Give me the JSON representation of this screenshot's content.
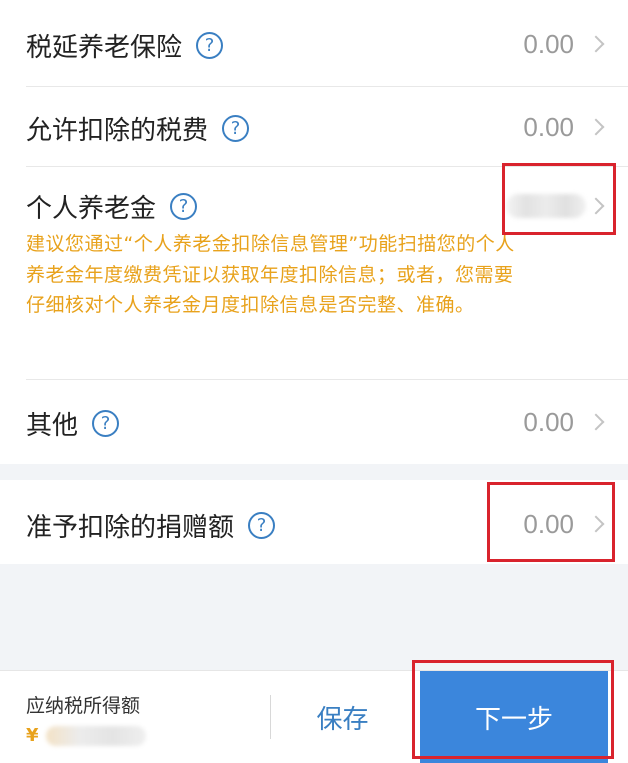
{
  "rows": [
    {
      "label": "税延养老保险",
      "help": "?",
      "value": "0.00"
    },
    {
      "label": "允许扣除的税费",
      "help": "?",
      "value": "0.00"
    },
    {
      "label": "个人养老金",
      "help": "?",
      "value": "",
      "note": "建议您通过“个人养老金扣除信息管理”功能扫描您的个人养老金年度缴费凭证以获取年度扣除信息；或者，您需要仔细核对个人养老金月度扣除信息是否完整、准确。"
    },
    {
      "label": "其他",
      "help": "?",
      "value": "0.00"
    }
  ],
  "donation": {
    "label": "准予扣除的捐赠额",
    "help": "?",
    "value": "0.00"
  },
  "bottom": {
    "tax_label": "应纳税所得额",
    "currency": "¥",
    "save_label": "保存",
    "next_label": "下一步"
  },
  "colors": {
    "accent_blue": "#3b86dc",
    "note_orange": "#e8a21c",
    "highlight_red": "#d9232d"
  }
}
